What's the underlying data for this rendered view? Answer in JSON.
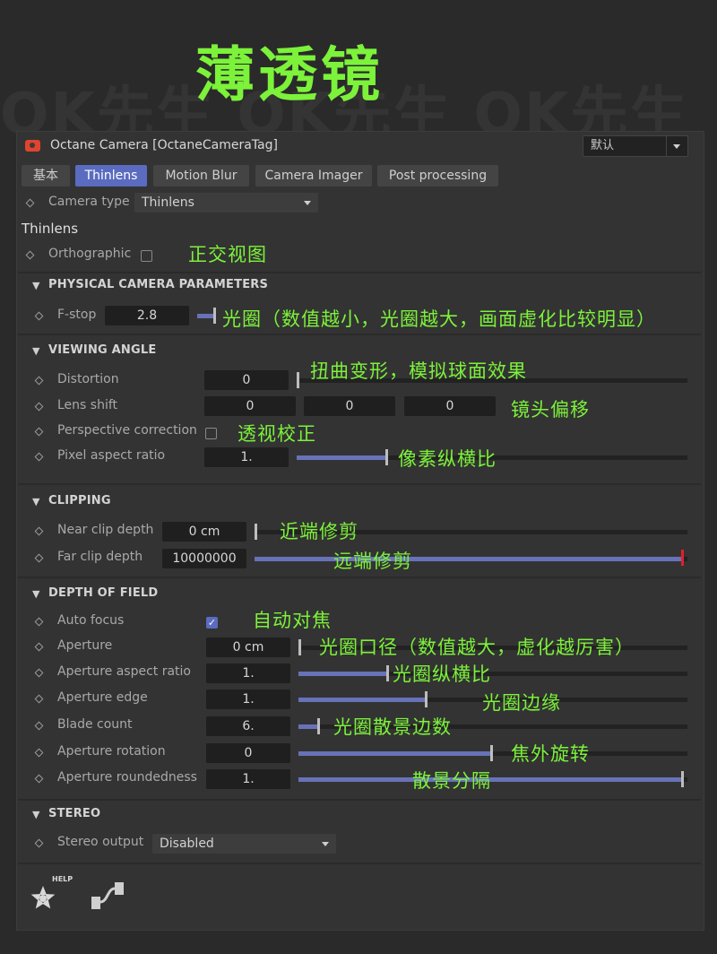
{
  "watermark": "OK先生 OK先生 OK先生",
  "page_title": "薄透镜",
  "panel": {
    "title": "Octane Camera [OctaneCameraTag]",
    "preset": "默认",
    "camera_icon": "camera-icon"
  },
  "tabs": [
    {
      "label": "基本",
      "active": false
    },
    {
      "label": "Thinlens",
      "active": true
    },
    {
      "label": "Motion Blur",
      "active": false
    },
    {
      "label": "Camera Imager",
      "active": false
    },
    {
      "label": "Post processing",
      "active": false
    }
  ],
  "camera_type": {
    "label": "Camera type",
    "value": "Thinlens"
  },
  "group_title": "Thinlens",
  "orthographic": {
    "label": "Orthographic",
    "checked": false
  },
  "physical": {
    "title": "PHYSICAL CAMERA PARAMETERS",
    "fstop": {
      "label": "F-stop",
      "value": "2.8",
      "level": 0.05
    }
  },
  "viewing": {
    "title": "VIEWING ANGLE",
    "distortion": {
      "label": "Distortion",
      "value": "0",
      "level": 0
    },
    "lens_shift": {
      "label": "Lens shift",
      "x": "0",
      "y": "0",
      "z": "0"
    },
    "perspective": {
      "label": "Perspective correction",
      "checked": false
    },
    "pixel_aspect": {
      "label": "Pixel aspect ratio",
      "value": "1.",
      "level": 0.23
    }
  },
  "clipping": {
    "title": "CLIPPING",
    "near": {
      "label": "Near clip depth",
      "value": "0 cm",
      "level": 0
    },
    "far": {
      "label": "Far clip depth",
      "value": "10000000",
      "level": 1.0
    }
  },
  "dof": {
    "title": "DEPTH OF FIELD",
    "autofocus": {
      "label": "Auto focus",
      "checked": true
    },
    "aperture": {
      "label": "Aperture",
      "value": "0 cm",
      "level": 0
    },
    "aperture_aspect": {
      "label": "Aperture aspect ratio",
      "value": "1.",
      "level": 0.23
    },
    "aperture_edge": {
      "label": "Aperture edge",
      "value": "1.",
      "level": 0.33
    },
    "blade_count": {
      "label": "Blade count",
      "value": "6.",
      "level": 0.05
    },
    "aperture_rotation": {
      "label": "Aperture rotation",
      "value": "0",
      "level": 0.5
    },
    "aperture_roundedness": {
      "label": "Aperture roundedness",
      "value": "1.",
      "level": 1.0
    }
  },
  "stereo": {
    "title": "STEREO",
    "output": {
      "label": "Stereo output",
      "value": "Disabled"
    }
  },
  "footer": {
    "help_label": "HELP",
    "help_icon": "octane-help-icon",
    "node_icon": "node-editor-icon"
  },
  "annotations": {
    "orthographic": "正交视图",
    "fstop": "光圈（数值越小，光圈越大，画面虚化比较明显）",
    "distortion": "扭曲变形，模拟球面效果",
    "lens_shift": "镜头偏移",
    "perspective": "透视校正",
    "pixel_aspect": "像素纵横比",
    "near": "近端修剪",
    "far": "远端修剪",
    "autofocus": "自动对焦",
    "aperture": "光圈口径（数值越大，虚化越厉害）",
    "aperture_aspect": "光圈纵横比",
    "aperture_edge": "光圈边缘",
    "blade_count": "光圈散景边数",
    "aperture_rotation": "焦外旋转",
    "aperture_roundedness": "散景分隔"
  },
  "colors": {
    "accent": "#5a6bc0",
    "annotation": "#7cf23a",
    "slider_fill": "#6872b8",
    "far_handle": "#e0202a"
  }
}
